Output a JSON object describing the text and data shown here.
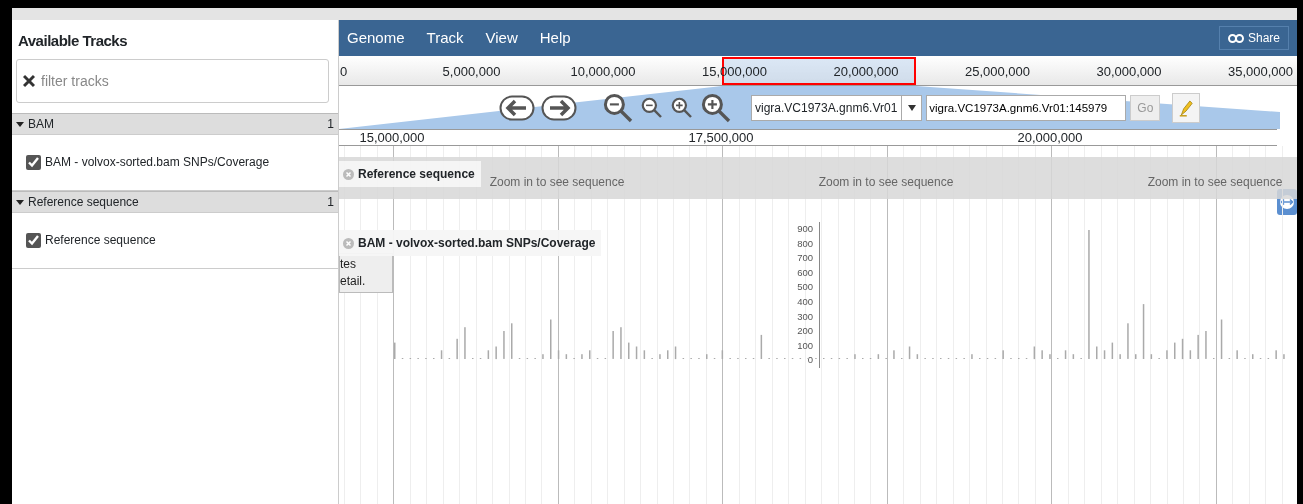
{
  "sidebar": {
    "title": "Available Tracks",
    "filter": {
      "placeholder": "filter tracks"
    },
    "categories": [
      {
        "name": "BAM",
        "count": "1",
        "expanded": true,
        "tracks": [
          {
            "label": "BAM - volvox-sorted.bam SNPs/Coverage",
            "checked": true
          }
        ]
      },
      {
        "name": "Reference sequence",
        "count": "1",
        "expanded": true,
        "tracks": [
          {
            "label": "Reference sequence",
            "checked": true
          }
        ]
      }
    ]
  },
  "menu": [
    "Genome",
    "Track",
    "View",
    "Help"
  ],
  "share": "Share",
  "overview_ruler": [
    "0",
    "5,000,000",
    "10,000,000",
    "15,000,000",
    "20,000,000",
    "25,000,000",
    "30,000,000",
    "35,000,000"
  ],
  "navigation": {
    "reference": "vigra.VC1973A.gnm6.Vr01",
    "location": "vigra.VC1973A.gnm6.Vr01:145979",
    "go": "Go"
  },
  "detail_ruler": [
    "15,000,000",
    "17,500,000",
    "20,000,000"
  ],
  "tracks": [
    {
      "kind": "sequence",
      "label": "Reference sequence",
      "messages": [
        "Zoom in to see sequence",
        "Zoom in to see sequence",
        "Zoom in to see sequence"
      ]
    },
    {
      "kind": "coverage",
      "label": "BAM - volvox-sorted.bam SNPs/Coverage",
      "y_axis": [
        "900",
        "800",
        "700",
        "600",
        "500",
        "400",
        "300",
        "200",
        "100",
        "0"
      ],
      "hidden_note": [
        "tes",
        "etail."
      ]
    }
  ]
}
